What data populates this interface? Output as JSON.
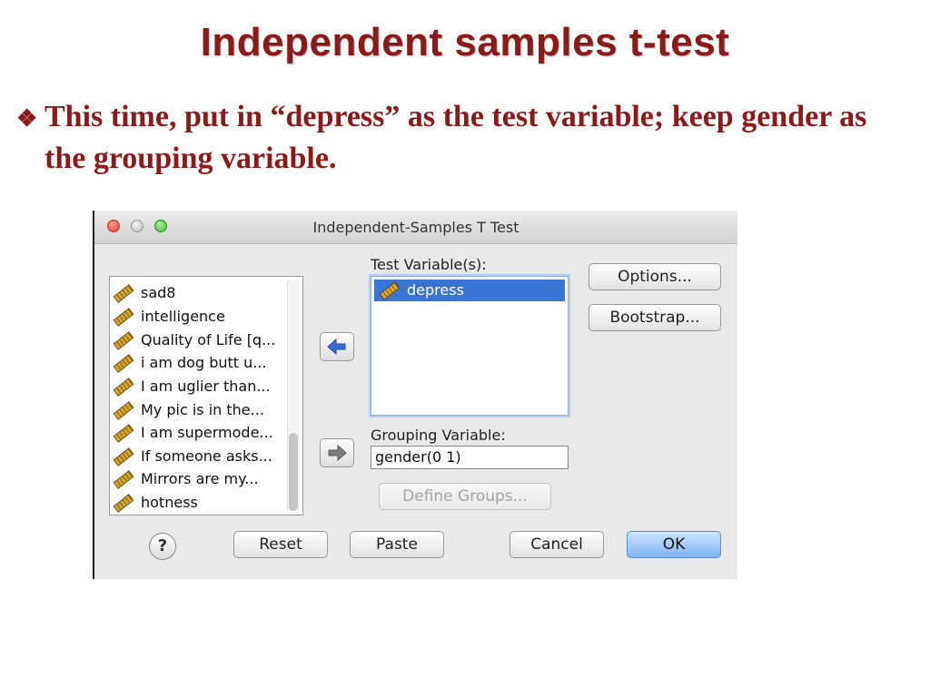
{
  "slide": {
    "title": "Independent samples t-test",
    "bullet_mark": "❖",
    "bullet_text": "This time, put in “depress” as the test variable; keep gender as the grouping variable."
  },
  "dialog": {
    "title": "Independent-Samples T Test",
    "variables": [
      "sad8",
      "intelligence",
      "Quality of Life [q...",
      "i am dog butt u...",
      "I am uglier than...",
      "My pic is in the...",
      "I am supermode...",
      "If someone asks...",
      "Mirrors are my...",
      "hotness"
    ],
    "variable_icon": "ruler-icon",
    "test_variables_label": "Test Variable(s):",
    "test_variables": [
      "depress"
    ],
    "grouping_label": "Grouping Variable:",
    "grouping_value": "gender(0 1)",
    "buttons": {
      "options": "Options...",
      "bootstrap": "Bootstrap...",
      "define_groups": "Define Groups...",
      "reset": "Reset",
      "paste": "Paste",
      "cancel": "Cancel",
      "ok": "OK",
      "help": "?"
    },
    "arrows": {
      "move_left": "arrow-left-icon",
      "move_right": "arrow-right-icon"
    },
    "colors": {
      "selection": "#3875d7",
      "ok_button": "#7fb3f3",
      "title_red": "#8b1a1a"
    }
  }
}
